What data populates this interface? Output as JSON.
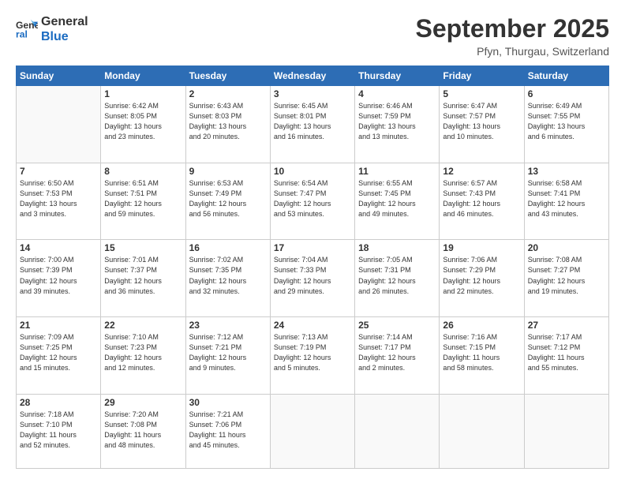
{
  "logo": {
    "line1": "General",
    "line2": "Blue"
  },
  "title": "September 2025",
  "subtitle": "Pfyn, Thurgau, Switzerland",
  "weekdays": [
    "Sunday",
    "Monday",
    "Tuesday",
    "Wednesday",
    "Thursday",
    "Friday",
    "Saturday"
  ],
  "weeks": [
    [
      {
        "day": "",
        "info": ""
      },
      {
        "day": "1",
        "info": "Sunrise: 6:42 AM\nSunset: 8:05 PM\nDaylight: 13 hours\nand 23 minutes."
      },
      {
        "day": "2",
        "info": "Sunrise: 6:43 AM\nSunset: 8:03 PM\nDaylight: 13 hours\nand 20 minutes."
      },
      {
        "day": "3",
        "info": "Sunrise: 6:45 AM\nSunset: 8:01 PM\nDaylight: 13 hours\nand 16 minutes."
      },
      {
        "day": "4",
        "info": "Sunrise: 6:46 AM\nSunset: 7:59 PM\nDaylight: 13 hours\nand 13 minutes."
      },
      {
        "day": "5",
        "info": "Sunrise: 6:47 AM\nSunset: 7:57 PM\nDaylight: 13 hours\nand 10 minutes."
      },
      {
        "day": "6",
        "info": "Sunrise: 6:49 AM\nSunset: 7:55 PM\nDaylight: 13 hours\nand 6 minutes."
      }
    ],
    [
      {
        "day": "7",
        "info": "Sunrise: 6:50 AM\nSunset: 7:53 PM\nDaylight: 13 hours\nand 3 minutes."
      },
      {
        "day": "8",
        "info": "Sunrise: 6:51 AM\nSunset: 7:51 PM\nDaylight: 12 hours\nand 59 minutes."
      },
      {
        "day": "9",
        "info": "Sunrise: 6:53 AM\nSunset: 7:49 PM\nDaylight: 12 hours\nand 56 minutes."
      },
      {
        "day": "10",
        "info": "Sunrise: 6:54 AM\nSunset: 7:47 PM\nDaylight: 12 hours\nand 53 minutes."
      },
      {
        "day": "11",
        "info": "Sunrise: 6:55 AM\nSunset: 7:45 PM\nDaylight: 12 hours\nand 49 minutes."
      },
      {
        "day": "12",
        "info": "Sunrise: 6:57 AM\nSunset: 7:43 PM\nDaylight: 12 hours\nand 46 minutes."
      },
      {
        "day": "13",
        "info": "Sunrise: 6:58 AM\nSunset: 7:41 PM\nDaylight: 12 hours\nand 43 minutes."
      }
    ],
    [
      {
        "day": "14",
        "info": "Sunrise: 7:00 AM\nSunset: 7:39 PM\nDaylight: 12 hours\nand 39 minutes."
      },
      {
        "day": "15",
        "info": "Sunrise: 7:01 AM\nSunset: 7:37 PM\nDaylight: 12 hours\nand 36 minutes."
      },
      {
        "day": "16",
        "info": "Sunrise: 7:02 AM\nSunset: 7:35 PM\nDaylight: 12 hours\nand 32 minutes."
      },
      {
        "day": "17",
        "info": "Sunrise: 7:04 AM\nSunset: 7:33 PM\nDaylight: 12 hours\nand 29 minutes."
      },
      {
        "day": "18",
        "info": "Sunrise: 7:05 AM\nSunset: 7:31 PM\nDaylight: 12 hours\nand 26 minutes."
      },
      {
        "day": "19",
        "info": "Sunrise: 7:06 AM\nSunset: 7:29 PM\nDaylight: 12 hours\nand 22 minutes."
      },
      {
        "day": "20",
        "info": "Sunrise: 7:08 AM\nSunset: 7:27 PM\nDaylight: 12 hours\nand 19 minutes."
      }
    ],
    [
      {
        "day": "21",
        "info": "Sunrise: 7:09 AM\nSunset: 7:25 PM\nDaylight: 12 hours\nand 15 minutes."
      },
      {
        "day": "22",
        "info": "Sunrise: 7:10 AM\nSunset: 7:23 PM\nDaylight: 12 hours\nand 12 minutes."
      },
      {
        "day": "23",
        "info": "Sunrise: 7:12 AM\nSunset: 7:21 PM\nDaylight: 12 hours\nand 9 minutes."
      },
      {
        "day": "24",
        "info": "Sunrise: 7:13 AM\nSunset: 7:19 PM\nDaylight: 12 hours\nand 5 minutes."
      },
      {
        "day": "25",
        "info": "Sunrise: 7:14 AM\nSunset: 7:17 PM\nDaylight: 12 hours\nand 2 minutes."
      },
      {
        "day": "26",
        "info": "Sunrise: 7:16 AM\nSunset: 7:15 PM\nDaylight: 11 hours\nand 58 minutes."
      },
      {
        "day": "27",
        "info": "Sunrise: 7:17 AM\nSunset: 7:12 PM\nDaylight: 11 hours\nand 55 minutes."
      }
    ],
    [
      {
        "day": "28",
        "info": "Sunrise: 7:18 AM\nSunset: 7:10 PM\nDaylight: 11 hours\nand 52 minutes."
      },
      {
        "day": "29",
        "info": "Sunrise: 7:20 AM\nSunset: 7:08 PM\nDaylight: 11 hours\nand 48 minutes."
      },
      {
        "day": "30",
        "info": "Sunrise: 7:21 AM\nSunset: 7:06 PM\nDaylight: 11 hours\nand 45 minutes."
      },
      {
        "day": "",
        "info": ""
      },
      {
        "day": "",
        "info": ""
      },
      {
        "day": "",
        "info": ""
      },
      {
        "day": "",
        "info": ""
      }
    ]
  ]
}
